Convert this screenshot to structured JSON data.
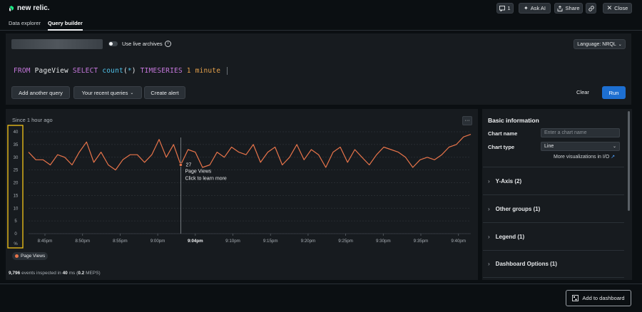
{
  "app": {
    "logo_text": "new relic.",
    "comment_count": "1",
    "ask_ai_label": "Ask AI",
    "share_label": "Share",
    "close_label": "Close"
  },
  "tabs": [
    {
      "label": "Data explorer",
      "active": false
    },
    {
      "label": "Query builder",
      "active": true
    }
  ],
  "query_bar": {
    "live_archives_label": "Use live archives",
    "language_label": "Language: NRQL",
    "query_tokens": [
      {
        "text": "FROM",
        "kind": "keyword"
      },
      {
        "text": "PageView",
        "kind": "plain"
      },
      {
        "text": "SELECT",
        "kind": "keyword"
      },
      {
        "text": "count",
        "kind": "function"
      },
      {
        "text": "(",
        "kind": "plain"
      },
      {
        "text": "*",
        "kind": "function"
      },
      {
        "text": ")",
        "kind": "plain"
      },
      {
        "text": "TIMESERIES",
        "kind": "keyword"
      },
      {
        "text": "1 minute",
        "kind": "number"
      }
    ],
    "add_query_label": "Add another query",
    "recent_queries_label": "Your recent queries",
    "create_alert_label": "Create alert",
    "clear_label": "Clear",
    "run_label": "Run"
  },
  "chart_panel": {
    "time_range": "Since 1 hour ago",
    "more_label": "···",
    "legend_label": "Page Views",
    "footer": {
      "events": "9,796",
      "events_suffix": "events inspected in",
      "ms": "40",
      "ms_suffix": "ms (",
      "meps": "0.2",
      "meps_suffix": "MEPS)"
    },
    "tooltip": {
      "value": "27",
      "series": "Page Views",
      "hint": "Click to learn more"
    }
  },
  "chart_data": {
    "type": "line",
    "series": [
      {
        "name": "Page Views",
        "color": "#e8744a",
        "values": [
          32,
          29,
          29,
          27,
          31,
          30,
          27,
          32,
          36,
          28,
          32,
          27,
          25,
          29,
          31,
          31,
          28,
          31,
          37,
          30,
          35,
          27,
          33,
          32,
          26,
          27,
          32,
          30,
          34,
          32,
          31,
          35,
          28,
          32,
          34,
          27,
          30,
          35,
          29,
          33,
          31,
          26,
          32,
          34,
          28,
          33,
          30,
          27,
          31,
          34,
          33,
          32,
          30,
          26,
          29,
          30,
          29,
          31,
          34,
          35,
          38,
          39
        ]
      }
    ],
    "x_ticks": [
      "8:45pm",
      "8:50pm",
      "8:55pm",
      "9:00pm",
      "9:04pm",
      "9:10pm",
      "9:15pm",
      "9:20pm",
      "9:25pm",
      "9:30pm",
      "9:35pm",
      "9:40pm"
    ],
    "y_ticks": [
      "40",
      "35",
      "30",
      "25",
      "20",
      "15",
      "10",
      "5",
      "0"
    ],
    "y_unit": "%",
    "ylim": [
      0,
      40
    ],
    "hover_index": 21,
    "grid": true
  },
  "settings": {
    "section_title": "Basic information",
    "chart_name_label": "Chart name",
    "chart_name_placeholder": "Enter a chart name",
    "chart_type_label": "Chart type",
    "chart_type_value": "Line",
    "more_viz_label": "More visualizations in I/O",
    "sections": [
      "Y-Axis (2)",
      "Other groups (1)",
      "Legend (1)",
      "Dashboard Options (1)"
    ]
  },
  "footer_bar": {
    "add_dashboard_label": "Add to dashboard"
  }
}
